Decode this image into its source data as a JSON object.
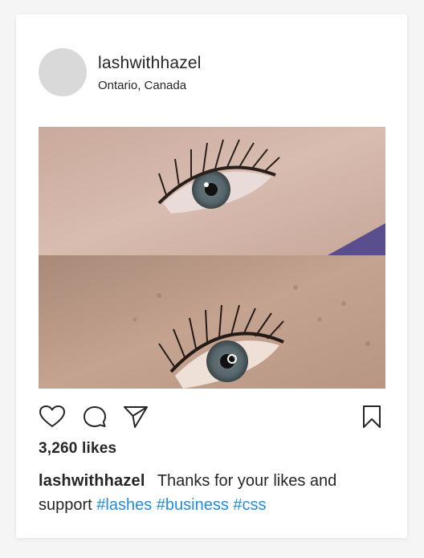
{
  "post": {
    "username": "lashwithhazel",
    "location": "Ontario, Canada",
    "likes": "3,260 likes",
    "caption": {
      "username": "lashwithhazel",
      "text": "Thanks for your likes and support",
      "tags": [
        "#lashes",
        "#business",
        "#css"
      ]
    },
    "photo": {
      "icon": "eyelash-photo"
    }
  },
  "icons": {
    "like": "heart-icon",
    "comment": "comment-icon",
    "share": "send-icon",
    "save": "bookmark-icon"
  },
  "colors": {
    "hashtag": "#1f8ceb",
    "text": "#262626",
    "avatar": "#d9d9d9"
  }
}
